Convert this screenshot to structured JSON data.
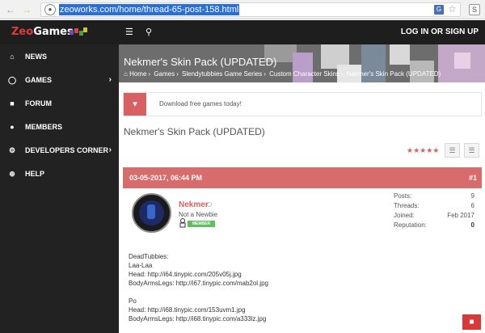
{
  "browser": {
    "url": "zeoworks.com/home/thread-65-post-158.html",
    "ext_label": "S"
  },
  "header": {
    "logo_zeo": "Zeo",
    "logo_games": "Games",
    "login_label": "LOG IN OR SIGN UP"
  },
  "sidebar": {
    "items": [
      {
        "label": "NEWS",
        "icon": "home-icon",
        "has_chevron": false
      },
      {
        "label": "GAMES",
        "icon": "gamepad-icon",
        "has_chevron": true
      },
      {
        "label": "FORUM",
        "icon": "chat-icon",
        "has_chevron": false
      },
      {
        "label": "MEMBERS",
        "icon": "users-icon",
        "has_chevron": false
      },
      {
        "label": "DEVELOPERS CORNER",
        "icon": "gear-icon",
        "has_chevron": true
      },
      {
        "label": "HELP",
        "icon": "help-icon",
        "has_chevron": false
      }
    ]
  },
  "banner": {
    "title": "Nekmer's Skin Pack (UPDATED)",
    "breadcrumbs": [
      "Home",
      "Games",
      "Slendytubbies Game Series",
      "Custom Character Skins",
      "Nekmer's Skin Pack (UPDATED)"
    ]
  },
  "notice": {
    "text": "Download free games today!"
  },
  "thread": {
    "title": "Nekmer's Skin Pack (UPDATED)",
    "rating_stars": "★★★★★",
    "rating_value": 5
  },
  "post": {
    "date": "03-05-2017, 06:44 PM",
    "number": "#1",
    "username": "Nekmer",
    "user_title": "Not a Newbie",
    "badge": "MEMBER",
    "stats": [
      {
        "label": "Posts:",
        "value": "9",
        "bold": false
      },
      {
        "label": "Threads:",
        "value": "6",
        "bold": false
      },
      {
        "label": "Joined:",
        "value": "Feb 2017",
        "bold": false
      },
      {
        "label": "Reputation:",
        "value": "0",
        "bold": true
      }
    ],
    "lines": [
      "DeadTubbies:",
      "Laa-Laa",
      "Head: http://i64.tinypic.com/205v05j.jpg",
      "BodyArmsLegs: http://i67.tinypic.com/mab2ol.jpg",
      "",
      "Po",
      "Head: http://i68.tinypic.com/153uvm1.jpg",
      "BodyArmsLegs: http://i68.tinypic.com/a333lz.jpg"
    ]
  },
  "colors": {
    "accent": "#d86b6b",
    "sidebar_bg": "#222222",
    "header_bg": "#1e1e1e"
  }
}
